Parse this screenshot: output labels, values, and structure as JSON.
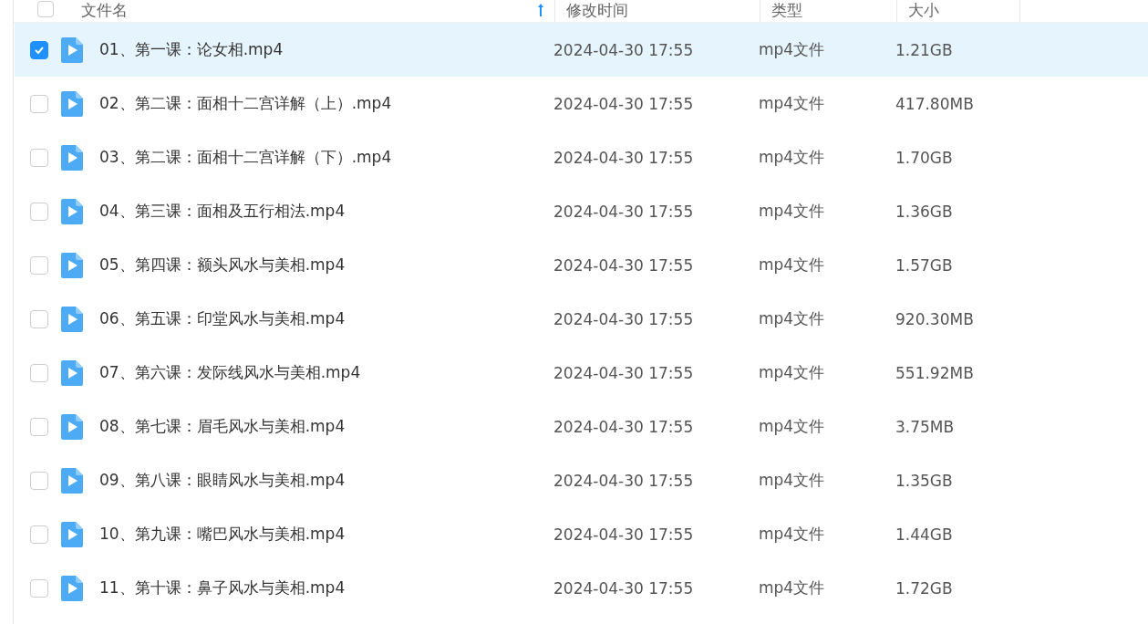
{
  "table": {
    "all_selected": false,
    "columns": [
      {
        "label": "文件名",
        "sorted": true
      },
      {
        "label": "修改时间",
        "sorted": false
      },
      {
        "label": "类型",
        "sorted": false
      },
      {
        "label": "大小",
        "sorted": false
      }
    ],
    "rows": [
      {
        "name": "01、第一课：论女相.mp4",
        "modified": "2024-04-30 17:55",
        "type": "mp4文件",
        "size": "1.21GB",
        "selected": true
      },
      {
        "name": "02、第二课：面相十二宫详解（上）.mp4",
        "modified": "2024-04-30 17:55",
        "type": "mp4文件",
        "size": "417.80MB",
        "selected": false
      },
      {
        "name": "03、第二课：面相十二宫详解（下）.mp4",
        "modified": "2024-04-30 17:55",
        "type": "mp4文件",
        "size": "1.70GB",
        "selected": false
      },
      {
        "name": "04、第三课：面相及五行相法.mp4",
        "modified": "2024-04-30 17:55",
        "type": "mp4文件",
        "size": "1.36GB",
        "selected": false
      },
      {
        "name": "05、第四课：额头风水与美相.mp4",
        "modified": "2024-04-30 17:55",
        "type": "mp4文件",
        "size": "1.57GB",
        "selected": false
      },
      {
        "name": "06、第五课：印堂风水与美相.mp4",
        "modified": "2024-04-30 17:55",
        "type": "mp4文件",
        "size": "920.30MB",
        "selected": false
      },
      {
        "name": "07、第六课：发际线风水与美相.mp4",
        "modified": "2024-04-30 17:55",
        "type": "mp4文件",
        "size": "551.92MB",
        "selected": false
      },
      {
        "name": "08、第七课：眉毛风水与美相.mp4",
        "modified": "2024-04-30 17:55",
        "type": "mp4文件",
        "size": "3.75MB",
        "selected": false
      },
      {
        "name": "09、第八课：眼睛风水与美相.mp4",
        "modified": "2024-04-30 17:55",
        "type": "mp4文件",
        "size": "1.35GB",
        "selected": false
      },
      {
        "name": "10、第九课：嘴巴风水与美相.mp4",
        "modified": "2024-04-30 17:55",
        "type": "mp4文件",
        "size": "1.44GB",
        "selected": false
      },
      {
        "name": "11、第十课：鼻子风水与美相.mp4",
        "modified": "2024-04-30 17:55",
        "type": "mp4文件",
        "size": "1.72GB",
        "selected": false
      }
    ]
  }
}
